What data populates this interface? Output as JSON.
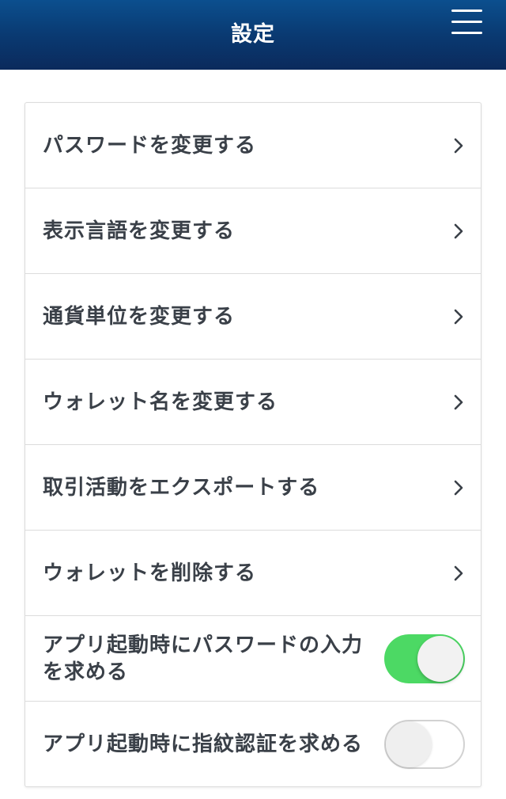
{
  "header": {
    "title": "設定",
    "menu_icon": "hamburger-menu-icon"
  },
  "settings": {
    "items": [
      {
        "label": "パスワードを変更する",
        "type": "link",
        "icon": "chevron-right-icon"
      },
      {
        "label": "表示言語を変更する",
        "type": "link",
        "icon": "chevron-right-icon"
      },
      {
        "label": "通貨単位を変更する",
        "type": "link",
        "icon": "chevron-right-icon"
      },
      {
        "label": "ウォレット名を変更する",
        "type": "link",
        "icon": "chevron-right-icon"
      },
      {
        "label": "取引活動をエクスポートする",
        "type": "link",
        "icon": "chevron-right-icon"
      },
      {
        "label": "ウォレットを削除する",
        "type": "link",
        "icon": "chevron-right-icon"
      },
      {
        "label": "アプリ起動時にパスワードの入力を求める",
        "type": "toggle",
        "enabled": true
      },
      {
        "label": "アプリ起動時に指紋認証を求める",
        "type": "toggle",
        "enabled": false
      }
    ]
  },
  "colors": {
    "header_top": "#0b4f8e",
    "header_bottom": "#0b2a5c",
    "toggle_on": "#4cd964",
    "text": "#3a4048"
  }
}
